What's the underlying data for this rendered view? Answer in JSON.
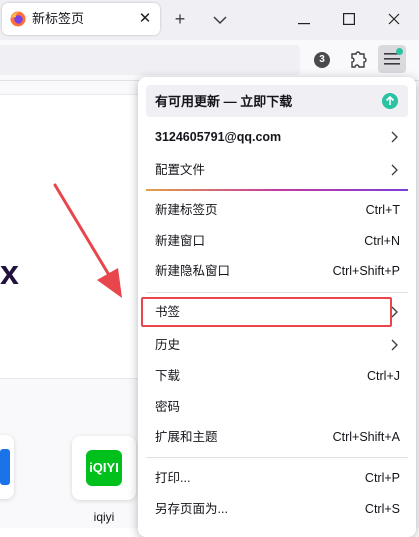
{
  "browser": {
    "tab": {
      "title": "新标签页",
      "close_glyph": "✕"
    },
    "new_tab_glyph": "+",
    "tab_list_glyph": "⌄",
    "window": {
      "minimize_glyph": "—",
      "maximize_glyph": "☐",
      "close_glyph": "✕"
    },
    "toolbar": {
      "badge_count": "3"
    }
  },
  "newtab": {
    "hero_partial_text": "x",
    "shortcuts": [
      {
        "label": "iqiyi",
        "logo_text": "iQIYI"
      }
    ]
  },
  "menu": {
    "update": {
      "label": "有可用更新 — 立即下载"
    },
    "account": {
      "label": "3124605791@qq.com"
    },
    "profiles": {
      "label": "配置文件"
    },
    "items": [
      {
        "label": "新建标签页",
        "shortcut": "Ctrl+T"
      },
      {
        "label": "新建窗口",
        "shortcut": "Ctrl+N"
      },
      {
        "label": "新建隐私窗口",
        "shortcut": "Ctrl+Shift+P"
      },
      {
        "label": "书签",
        "shortcut": ""
      },
      {
        "label": "历史",
        "shortcut": ""
      },
      {
        "label": "下载",
        "shortcut": "Ctrl+J"
      },
      {
        "label": "密码",
        "shortcut": ""
      },
      {
        "label": "扩展和主题",
        "shortcut": "Ctrl+Shift+A"
      },
      {
        "label": "打印...",
        "shortcut": "Ctrl+P"
      },
      {
        "label": "另存页面为...",
        "shortcut": "Ctrl+S"
      }
    ]
  },
  "colors": {
    "accent_teal": "#2ac3a2",
    "annotation_red": "#e8454c"
  },
  "icons": {
    "tab_favicon": "firefox-icon",
    "extensions": "puzzle-icon",
    "app_menu": "hamburger-icon",
    "update": "arrow-up-circle-icon",
    "submenu": "chevron-right-icon"
  }
}
